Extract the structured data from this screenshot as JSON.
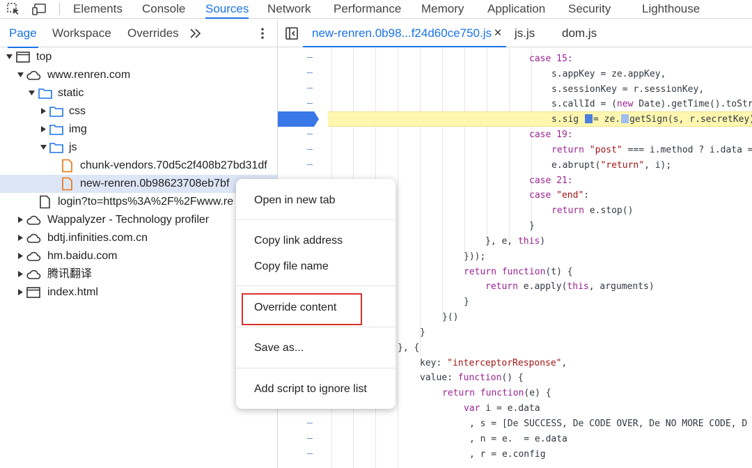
{
  "top_tabs": [
    "Elements",
    "Console",
    "Sources",
    "Network",
    "Performance",
    "Memory",
    "Application",
    "Security",
    "Lighthouse"
  ],
  "active_top_tab": "Sources",
  "nav_tabs": [
    "Page",
    "Workspace",
    "Overrides"
  ],
  "active_nav_tab": "Page",
  "tree": [
    {
      "label": "top"
    },
    {
      "label": "www.renren.com"
    },
    {
      "label": "static"
    },
    {
      "label": "css"
    },
    {
      "label": "img"
    },
    {
      "label": "js"
    },
    {
      "label": "chunk-vendors.70d5c2f408b27bd31df"
    },
    {
      "label": "new-renren.0b98623708eb7bf"
    },
    {
      "label": "login?to=https%3A%2F%2Fwww.re"
    },
    {
      "label": "Wappalyzer - Technology profiler"
    },
    {
      "label": "bdtj.infinities.com.cn"
    },
    {
      "label": "hm.baidu.com"
    },
    {
      "label": "腾讯翻译"
    },
    {
      "label": "index.html"
    }
  ],
  "editor_tabs": [
    "new-renren.0b98...f24d60ce750.js",
    "js.js",
    "dom.js"
  ],
  "close_tab_glyph": "×",
  "context_menu": {
    "open_new_tab": "Open in new tab",
    "copy_link": "Copy link address",
    "copy_file_name": "Copy file name",
    "override_content": "Override content",
    "save_as": "Save as...",
    "ignore_list": "Add script to ignore list"
  },
  "code": {
    "l1": "case 15:",
    "l2_a": "s.appKey = ze.appKey,",
    "l3_a": "s.sessionKey = r.sessionKey,",
    "l4_a": "s.callId = (",
    "l4_kw": "new",
    "l4_b": " Date).getTime().toStr",
    "l5_a": "s.sig ",
    "l5_b": "= ze.",
    "l5_c": "getSign(s, r.secretKey)",
    "l6": "case 19:",
    "l7_kw": "return",
    "l7_str": "\"post\"",
    "l7_b": " === i.method ? i.data =",
    "l8_a": "e.abrupt(",
    "l8_str": "\"return\"",
    "l8_b": ", i);",
    "l9": "case 21:",
    "l10_kw": "case",
    "l10_str": "\"end\"",
    "l10_b": ":",
    "l11_kw": "return",
    "l11_b": " e.stop()",
    "l12": "}",
    "l13_a": "}, e, ",
    "l13_kw": "this",
    "l13_b": ")",
    "l14": "}));",
    "l15_kw": "return",
    "l15_kw2": "function",
    "l15_b": "(t) {",
    "l16_kw": "return",
    "l16_a": " e.apply(",
    "l16_kw2": "this",
    "l16_b": ", arguments)",
    "l17": "}",
    "l18": "}()",
    "l19": "}",
    "l20": "}, {",
    "l21_a": "key: ",
    "l21_str": "\"interceptorResponse\"",
    "l21_b": ",",
    "l22_a": "value: ",
    "l22_kw": "function",
    "l22_b": "() {",
    "l23_kw": "return",
    "l23_kw2": "function",
    "l23_b": "(e) {",
    "l24_kw": "var",
    "l24_b": " i = e.data",
    "l25": ", s = [De SUCCESS, De CODE OVER, De NO MORE CODE, D",
    "l26": ", n = e.  = e.data",
    "l27": ", r = e.config"
  }
}
